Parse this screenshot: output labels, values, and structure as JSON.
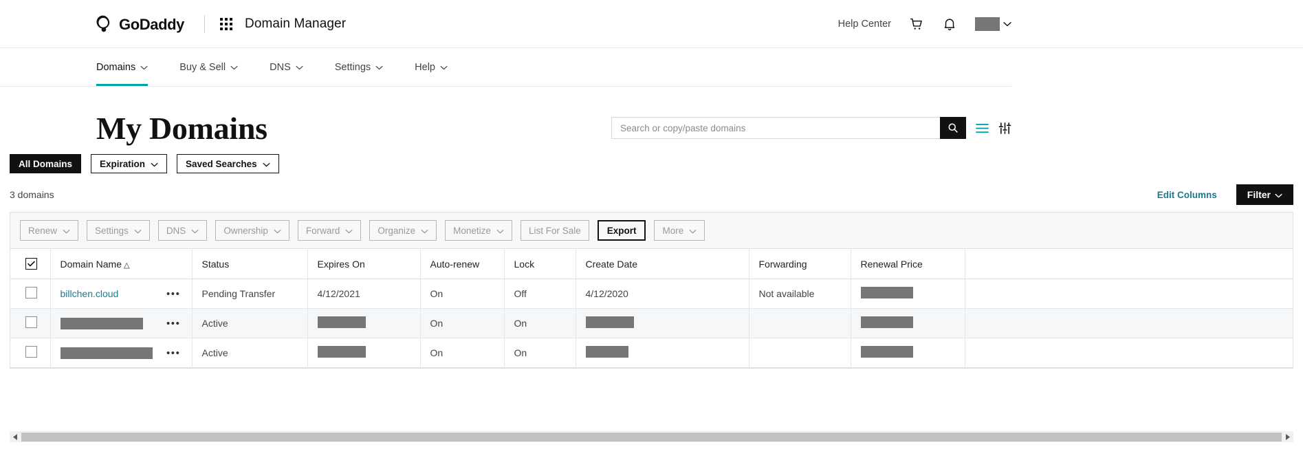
{
  "header": {
    "brand": "GoDaddy",
    "app_title": "Domain Manager",
    "help_center": "Help Center",
    "icons": {
      "grid": "app-grid-icon",
      "cart": "cart-icon",
      "bell": "bell-icon",
      "avatar": "avatar"
    }
  },
  "subnav": {
    "items": [
      {
        "label": "Domains",
        "active": true
      },
      {
        "label": "Buy & Sell",
        "active": false
      },
      {
        "label": "DNS",
        "active": false
      },
      {
        "label": "Settings",
        "active": false
      },
      {
        "label": "Help",
        "active": false
      }
    ]
  },
  "page": {
    "title": "My Domains",
    "count_text": "3 domains",
    "edit_columns": "Edit Columns",
    "filter_button": "Filter"
  },
  "search": {
    "placeholder": "Search or copy/paste domains",
    "value": ""
  },
  "tabs": [
    {
      "label": "All Domains",
      "style": "solid",
      "caret": false
    },
    {
      "label": "Expiration",
      "style": "outline",
      "caret": true
    },
    {
      "label": "Saved Searches",
      "style": "outline",
      "caret": true
    }
  ],
  "actions": [
    {
      "label": "Renew",
      "caret": true,
      "enabled": false
    },
    {
      "label": "Settings",
      "caret": true,
      "enabled": false
    },
    {
      "label": "DNS",
      "caret": true,
      "enabled": false
    },
    {
      "label": "Ownership",
      "caret": true,
      "enabled": false
    },
    {
      "label": "Forward",
      "caret": true,
      "enabled": false
    },
    {
      "label": "Organize",
      "caret": true,
      "enabled": false
    },
    {
      "label": "Monetize",
      "caret": true,
      "enabled": false
    },
    {
      "label": "List For Sale",
      "caret": false,
      "enabled": false
    },
    {
      "label": "Export",
      "caret": false,
      "enabled": true
    },
    {
      "label": "More",
      "caret": true,
      "enabled": false
    }
  ],
  "table": {
    "columns": [
      {
        "label": "Domain Name",
        "sort": "△"
      },
      {
        "label": "Status",
        "sort": ""
      },
      {
        "label": "Expires On",
        "sort": ""
      },
      {
        "label": "Auto-renew",
        "sort": ""
      },
      {
        "label": "Lock",
        "sort": ""
      },
      {
        "label": "Create Date",
        "sort": ""
      },
      {
        "label": "Forwarding",
        "sort": ""
      },
      {
        "label": "Renewal Price",
        "sort": ""
      }
    ],
    "header_checkbox_checked": true,
    "rows": [
      {
        "checked": false,
        "domain": "billchen.cloud",
        "domain_redacted": false,
        "domain_redact_width": 0,
        "status": "Pending Transfer",
        "expires_on": "4/12/2021",
        "expires_redacted": false,
        "expires_redact_width": 0,
        "auto_renew": "On",
        "lock": "Off",
        "create_date": "4/12/2020",
        "create_redacted": false,
        "create_redact_width": 0,
        "forwarding": "Not available",
        "renewal_price": "",
        "renewal_redacted": true,
        "renewal_redact_width": 76
      },
      {
        "checked": false,
        "domain": "",
        "domain_redacted": true,
        "domain_redact_width": 120,
        "status": "Active",
        "expires_on": "",
        "expires_redacted": true,
        "expires_redact_width": 70,
        "auto_renew": "On",
        "lock": "On",
        "create_date": "",
        "create_redacted": true,
        "create_redact_width": 70,
        "forwarding": "",
        "renewal_price": "",
        "renewal_redacted": true,
        "renewal_redact_width": 76
      },
      {
        "checked": false,
        "domain": "",
        "domain_redacted": true,
        "domain_redact_width": 134,
        "status": "Active",
        "expires_on": "",
        "expires_redacted": true,
        "expires_redact_width": 70,
        "auto_renew": "On",
        "lock": "On",
        "create_date": "",
        "create_redacted": true,
        "create_redact_width": 62,
        "forwarding": "",
        "renewal_price": "",
        "renewal_redacted": true,
        "renewal_redact_width": 76
      }
    ],
    "kebab_glyph": "•••"
  },
  "colors": {
    "accent_teal": "#00a4a6",
    "link": "#1c7a8c",
    "dark": "#111111",
    "redact": "#767676"
  }
}
